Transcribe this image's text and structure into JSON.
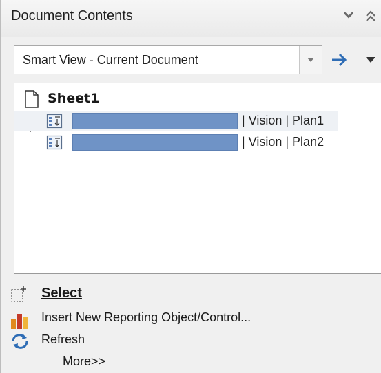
{
  "panel": {
    "title": "Document Contents",
    "collapse_icon": "double-chevron-down-icon",
    "expand_icon": "double-chevron-up-icon"
  },
  "source": {
    "selected": "Smart View - Current Document",
    "go_icon": "arrow-right-icon",
    "menu_icon": "dropdown-triangle-icon"
  },
  "tree": {
    "root_label": "Sheet1",
    "nodes": [
      {
        "label": "| Vision | Plan1",
        "redacted": true
      },
      {
        "label": "| Vision | Plan2",
        "redacted": true
      }
    ]
  },
  "actions": {
    "select": "Select",
    "insert": "Insert New Reporting Object/Control...",
    "refresh": "Refresh",
    "more": "More>>"
  },
  "colors": {
    "redaction": "#6f93c6",
    "arrow_blue": "#2f6db5"
  }
}
